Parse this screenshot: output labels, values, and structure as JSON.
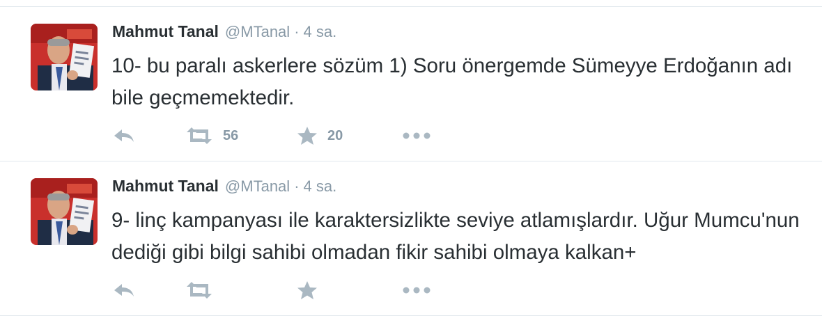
{
  "tweets": [
    {
      "fullname": "Mahmut Tanal",
      "username": "@MTanal",
      "separator": "·",
      "time": "4 sa.",
      "text": "10- bu paralı askerlere sözüm 1) Soru önergemde Sümeyye Erdoğanın adı bile geçmemektedir.",
      "retweet_count": "56",
      "favorite_count": "20"
    },
    {
      "fullname": "Mahmut Tanal",
      "username": "@MTanal",
      "separator": "·",
      "time": "4 sa.",
      "text": "9- linç kampanyası ile karaktersizlikte seviye atlamışlardır. Uğur Mumcu'nun dediği gibi bilgi sahibi olmadan fikir sahibi olmaya kalkan+",
      "retweet_count": "",
      "favorite_count": ""
    }
  ],
  "icons": {
    "reply": "reply-icon",
    "retweet": "retweet-icon",
    "favorite": "star-icon",
    "more": "more-dots-icon"
  },
  "colors": {
    "text": "#292f33",
    "meta": "#8899a6",
    "icon": "#aab8c2",
    "divider": "#e1e8ed"
  }
}
